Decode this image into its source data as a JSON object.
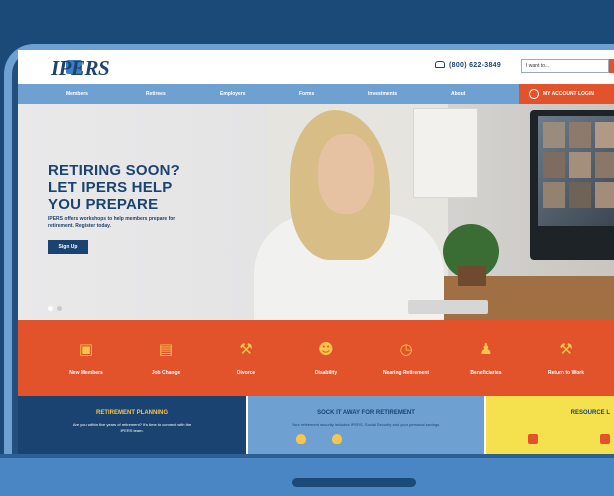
{
  "site": {
    "logo_text": "IPERS",
    "phone": "(800) 622-3849",
    "search_placeholder": "I want to...",
    "account_button": "MY ACCOUNT LOGIN"
  },
  "nav": [
    "Members",
    "Retirees",
    "Employers",
    "Forms",
    "Investments",
    "About"
  ],
  "hero": {
    "headline": [
      "RETIRING SOON?",
      "LET IPERS HELP",
      "YOU PREPARE"
    ],
    "subtext": "IPERS offers workshops to help members prepare for retirement. Register today.",
    "button": "Sign Up"
  },
  "tiles": [
    {
      "label": "New Members",
      "icon": "briefcase-icon",
      "glyph": "💼"
    },
    {
      "label": "Job Change",
      "icon": "document-icon",
      "glyph": "☰"
    },
    {
      "label": "Divorce",
      "icon": "gavel-icon",
      "glyph": "⚒"
    },
    {
      "label": "Disability",
      "icon": "person-icon",
      "glyph": "☺"
    },
    {
      "label": "Nearing Retirement",
      "icon": "clock-icon",
      "glyph": "◷"
    },
    {
      "label": "Beneficiaries",
      "icon": "people-icon",
      "glyph": "⚔"
    },
    {
      "label": "Return to Work",
      "icon": "worker-icon",
      "glyph": "⚒"
    }
  ],
  "cards": [
    {
      "title": "RETIREMENT PLANNING",
      "text": "Are you within five years of retirement? It's time to connect with the IPERS team."
    },
    {
      "title": "SOCK IT AWAY FOR RETIREMENT",
      "text": "Your retirement security includes IPERS, Social Security and your personal savings."
    },
    {
      "title": "RESOURCE L",
      "text": ""
    }
  ],
  "colors": {
    "navy": "#1b4371",
    "blue": "#6ea0d2",
    "orange": "#e2522b",
    "yellow": "#f7c64a",
    "background": "#1c4a78"
  }
}
